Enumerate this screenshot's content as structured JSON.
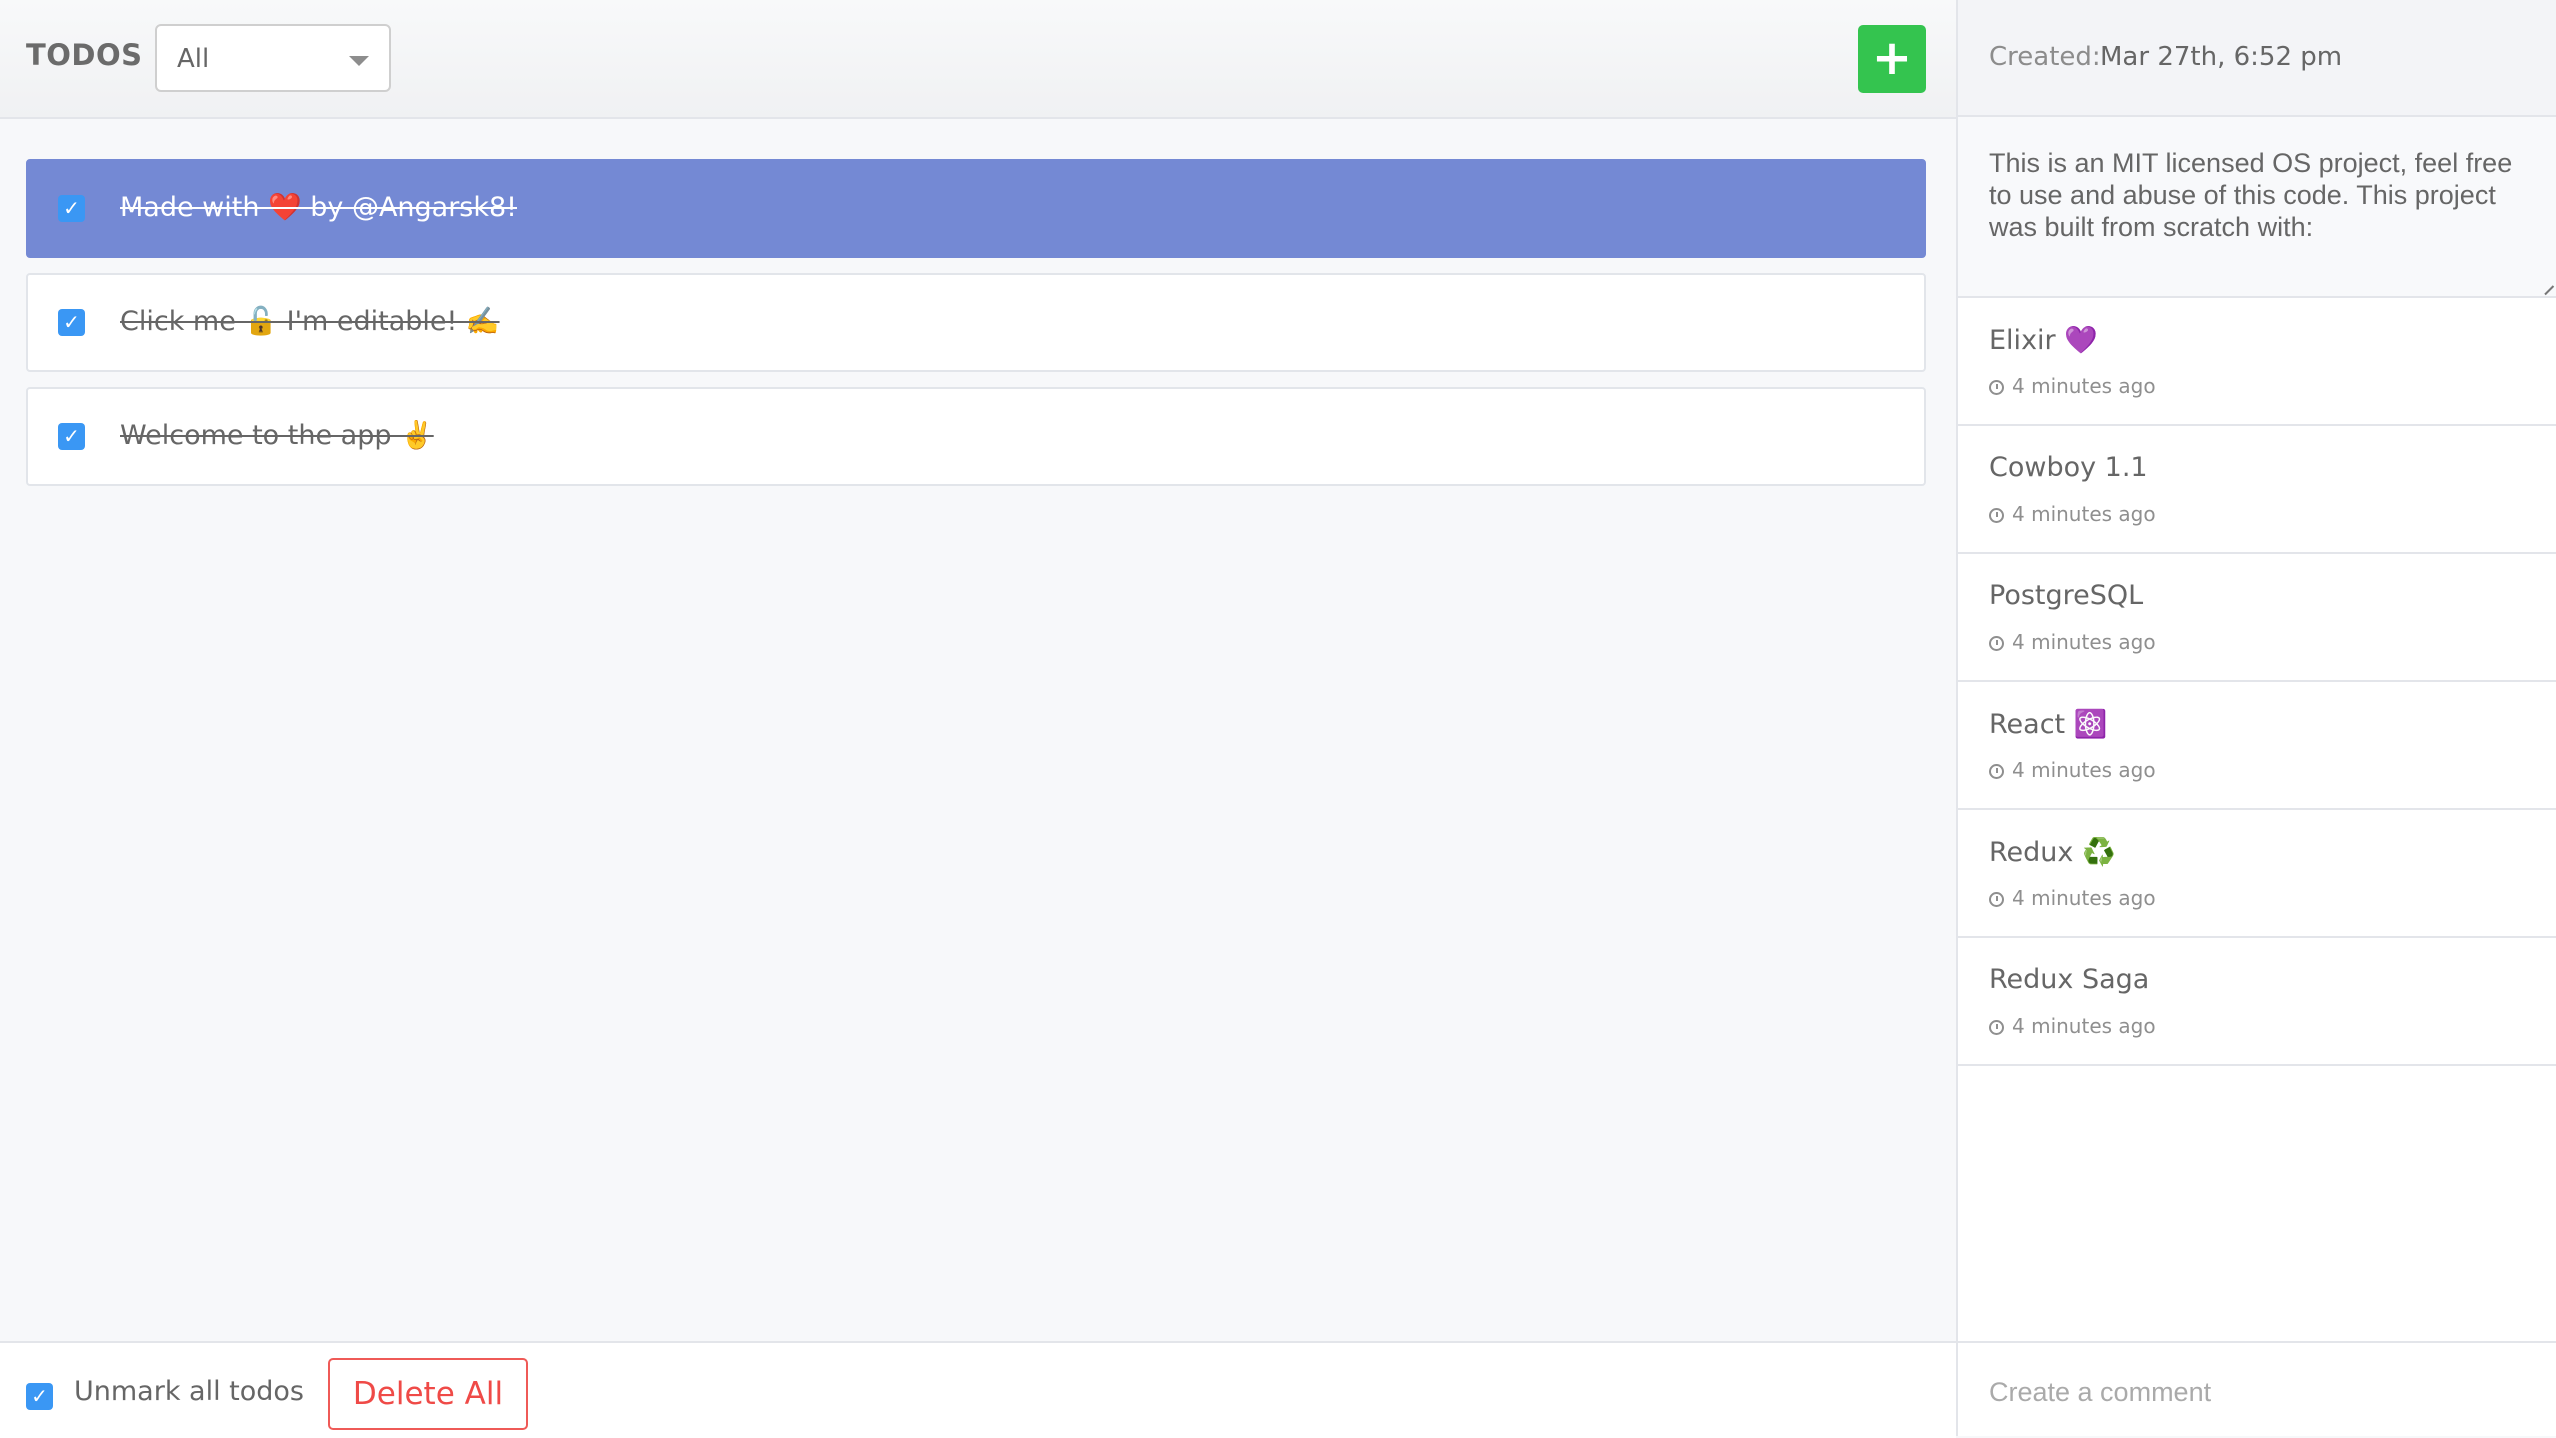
{
  "header": {
    "title": "TODOS",
    "filter": {
      "selected": "All"
    },
    "add_button_icon": "+"
  },
  "todos": [
    {
      "text": "Made with ❤️ by @Angarsk8!",
      "completed": true,
      "active": true
    },
    {
      "text": "Click me 🔓 I'm editable! ✍️",
      "completed": true,
      "active": false
    },
    {
      "text": "Welcome to the app ✌️",
      "completed": true,
      "active": false
    }
  ],
  "footer": {
    "toggle_all_label": "Unmark all todos",
    "toggle_all_checked": true,
    "delete_all_label": "Delete All"
  },
  "sidebar": {
    "created_label": "Created:",
    "created_value": "Mar 27th, 6:52 pm",
    "description": "This is an MIT licensed OS project, feel free to use and abuse of this code. This project was built from scratch with:",
    "comments": [
      {
        "title": "Elixir 💜",
        "time": "4 minutes ago"
      },
      {
        "title": "Cowboy 1.1",
        "time": "4 minutes ago"
      },
      {
        "title": "PostgreSQL",
        "time": "4 minutes ago"
      },
      {
        "title": "React ⚛️",
        "time": "4 minutes ago"
      },
      {
        "title": "Redux ♻️",
        "time": "4 minutes ago"
      },
      {
        "title": "Redux Saga",
        "time": "4 minutes ago"
      }
    ],
    "comment_placeholder": "Create a comment"
  },
  "colors": {
    "accent_active": "#7489d4",
    "add_button": "#34c44f",
    "checkbox": "#3a97f4",
    "delete": "#ef4a47"
  }
}
